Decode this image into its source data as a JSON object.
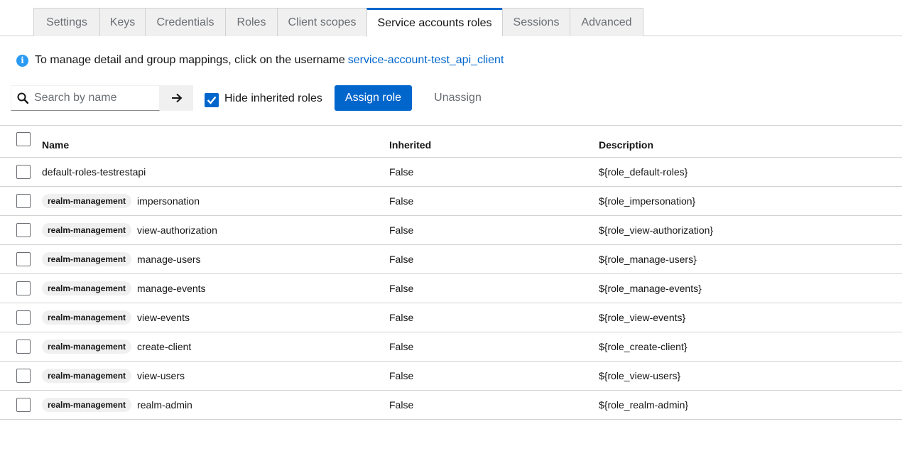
{
  "tabs": [
    {
      "label": "Settings",
      "active": false
    },
    {
      "label": "Keys",
      "active": false
    },
    {
      "label": "Credentials",
      "active": false
    },
    {
      "label": "Roles",
      "active": false
    },
    {
      "label": "Client scopes",
      "active": false
    },
    {
      "label": "Service accounts roles",
      "active": true
    },
    {
      "label": "Sessions",
      "active": false
    },
    {
      "label": "Advanced",
      "active": false
    }
  ],
  "info": {
    "text": "To manage detail and group mappings, click on the username",
    "link": "service-account-test_api_client",
    "icon": "info-icon"
  },
  "toolbar": {
    "search_placeholder": "Search by name",
    "hide_inherited_label": "Hide inherited roles",
    "hide_inherited_checked": true,
    "assign_label": "Assign role",
    "unassign_label": "Unassign"
  },
  "table": {
    "headers": {
      "name": "Name",
      "inherited": "Inherited",
      "description": "Description"
    },
    "rows": [
      {
        "badge": "",
        "name": "default-roles-testrestapi",
        "inherited": "False",
        "description": "${role_default-roles}"
      },
      {
        "badge": "realm-management",
        "name": "impersonation",
        "inherited": "False",
        "description": "${role_impersonation}"
      },
      {
        "badge": "realm-management",
        "name": "view-authorization",
        "inherited": "False",
        "description": "${role_view-authorization}"
      },
      {
        "badge": "realm-management",
        "name": "manage-users",
        "inherited": "False",
        "description": "${role_manage-users}"
      },
      {
        "badge": "realm-management",
        "name": "manage-events",
        "inherited": "False",
        "description": "${role_manage-events}"
      },
      {
        "badge": "realm-management",
        "name": "view-events",
        "inherited": "False",
        "description": "${role_view-events}"
      },
      {
        "badge": "realm-management",
        "name": "create-client",
        "inherited": "False",
        "description": "${role_create-client}"
      },
      {
        "badge": "realm-management",
        "name": "view-users",
        "inherited": "False",
        "description": "${role_view-users}"
      },
      {
        "badge": "realm-management",
        "name": "realm-admin",
        "inherited": "False",
        "description": "${role_realm-admin}"
      }
    ]
  },
  "colors": {
    "accent": "#0066cc",
    "info": "#2b9af3",
    "border": "#d2d2d2",
    "muted": "#6a6e73"
  }
}
